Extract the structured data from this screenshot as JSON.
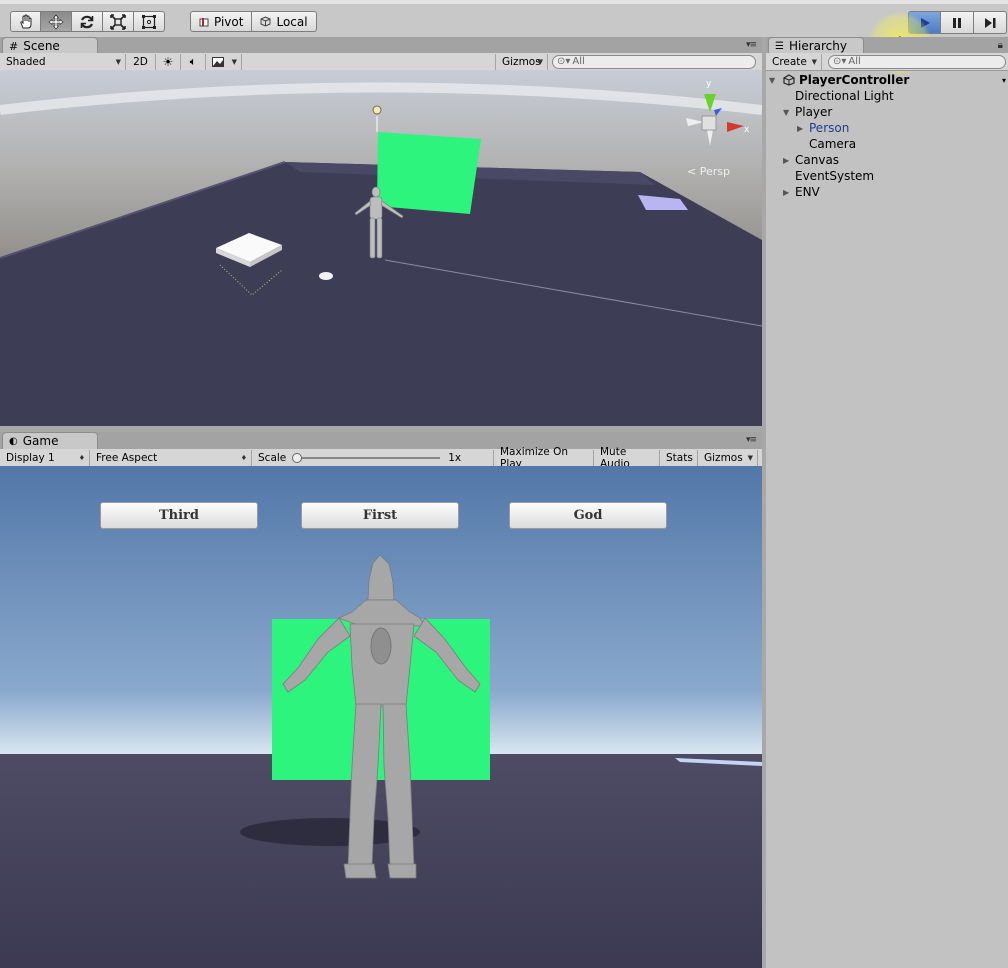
{
  "toolbar": {
    "tools": [
      "hand-tool-icon",
      "move-tool-icon",
      "rotate-tool-icon",
      "scale-tool-icon",
      "rect-tool-icon"
    ],
    "active_tool": "move",
    "pivot_label": "Pivot",
    "local_label": "Local"
  },
  "scene": {
    "tab_label": "Scene",
    "shading_mode": "Shaded",
    "btn_2d": "2D",
    "gizmos_label": "Gizmos",
    "search_placeholder": "All",
    "persp_label": "Persp",
    "gizmo_axis_x": "x",
    "gizmo_axis_y": "y"
  },
  "game": {
    "tab_label": "Game",
    "display": "Display 1",
    "aspect": "Free Aspect",
    "scale_label": "Scale",
    "scale_value": "1x",
    "maximize_label": "Maximize On Play",
    "mute_label": "Mute Audio",
    "stats_label": "Stats",
    "gizmos_label": "Gizmos",
    "buttons": [
      "Third",
      "First",
      "God"
    ]
  },
  "hierarchy": {
    "tab_label": "Hierarchy",
    "create_label": "Create",
    "search_placeholder": "All",
    "root": "PlayerController",
    "items": [
      {
        "label": "Directional Light"
      },
      {
        "label": "Player"
      },
      {
        "label": "Person"
      },
      {
        "label": "Camera"
      },
      {
        "label": "Canvas"
      },
      {
        "label": "EventSystem"
      },
      {
        "label": "ENV"
      }
    ]
  },
  "colors": {
    "green_panel": "#2cf47c",
    "ground": "#3e3d56",
    "selected_text": "#1f3d8f"
  }
}
